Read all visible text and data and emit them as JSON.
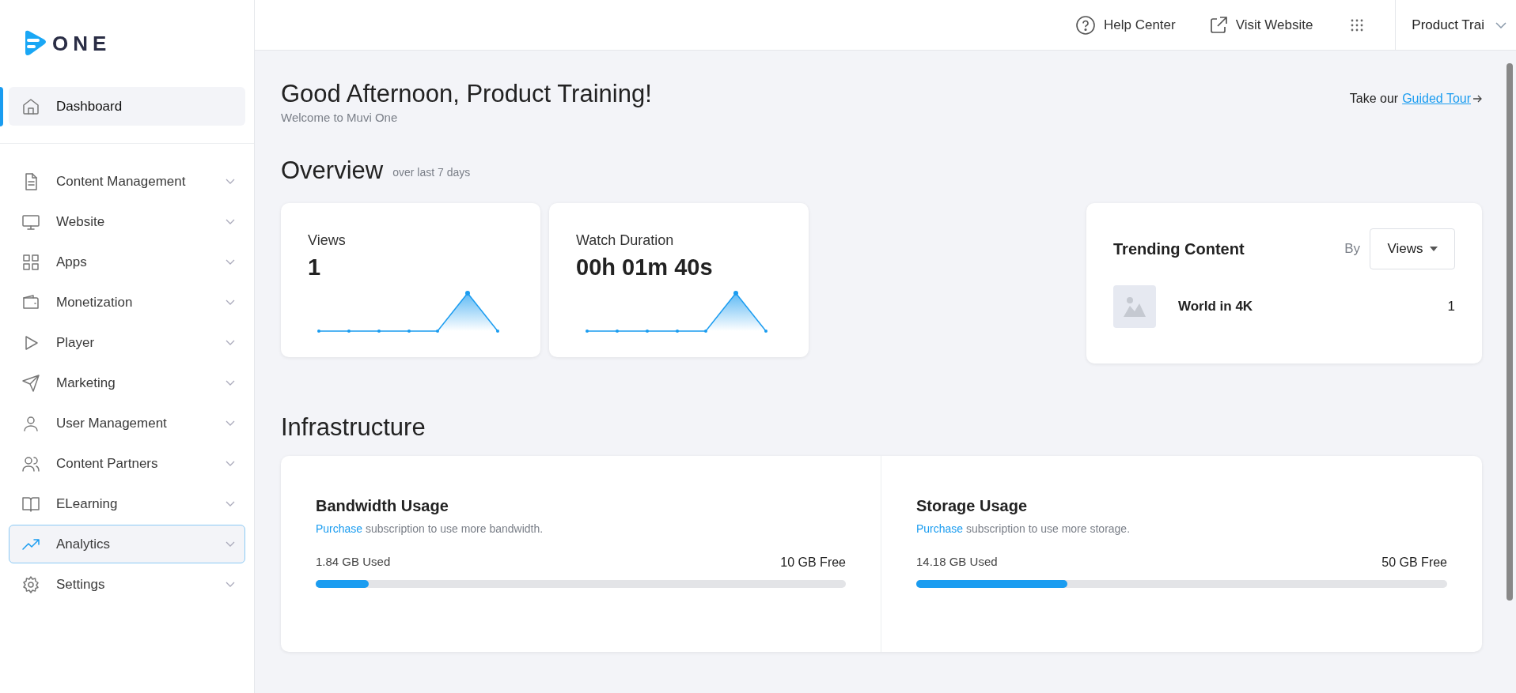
{
  "sidebar": {
    "logo": "ONE",
    "items": [
      {
        "label": "Dashboard",
        "selected": true,
        "hovered": false,
        "expandable": false
      },
      {
        "label": "Content Management",
        "selected": false,
        "hovered": false,
        "expandable": true
      },
      {
        "label": "Website",
        "selected": false,
        "hovered": false,
        "expandable": true
      },
      {
        "label": "Apps",
        "selected": false,
        "hovered": false,
        "expandable": true
      },
      {
        "label": "Monetization",
        "selected": false,
        "hovered": false,
        "expandable": true
      },
      {
        "label": "Player",
        "selected": false,
        "hovered": false,
        "expandable": true
      },
      {
        "label": "Marketing",
        "selected": false,
        "hovered": false,
        "expandable": true
      },
      {
        "label": "User Management",
        "selected": false,
        "hovered": false,
        "expandable": true
      },
      {
        "label": "Content Partners",
        "selected": false,
        "hovered": false,
        "expandable": true
      },
      {
        "label": "ELearning",
        "selected": false,
        "hovered": false,
        "expandable": true
      },
      {
        "label": "Analytics",
        "selected": false,
        "hovered": true,
        "expandable": true
      },
      {
        "label": "Settings",
        "selected": false,
        "hovered": false,
        "expandable": true
      }
    ]
  },
  "header": {
    "help": "Help Center",
    "visit": "Visit Website",
    "user": "Product Trai"
  },
  "greeting": {
    "title": "Good Afternoon, Product Training!",
    "subtitle": "Welcome to Muvi One",
    "tour_prefix": "Take our",
    "tour_link": "Guided Tour"
  },
  "overview": {
    "title": "Overview",
    "period": "over last 7 days",
    "stats": [
      {
        "label": "Views",
        "value": "1"
      },
      {
        "label": "Watch Duration",
        "value": "00h 01m 40s"
      }
    ],
    "trending": {
      "title": "Trending Content",
      "by": "By",
      "sort": "Views",
      "items": [
        {
          "title": "World in 4K",
          "count": "1"
        }
      ]
    }
  },
  "infrastructure": {
    "title": "Infrastructure",
    "panels": [
      {
        "title": "Bandwidth Usage",
        "link": "Purchase",
        "note": "subscription to use more bandwidth.",
        "used": "1.84 GB Used",
        "free": "10 GB Free",
        "level": 0.1
      },
      {
        "title": "Storage Usage",
        "link": "Purchase",
        "note": "subscription to use more storage.",
        "used": "14.18 GB Used",
        "free": "50 GB Free",
        "level": 0.284
      }
    ]
  }
}
